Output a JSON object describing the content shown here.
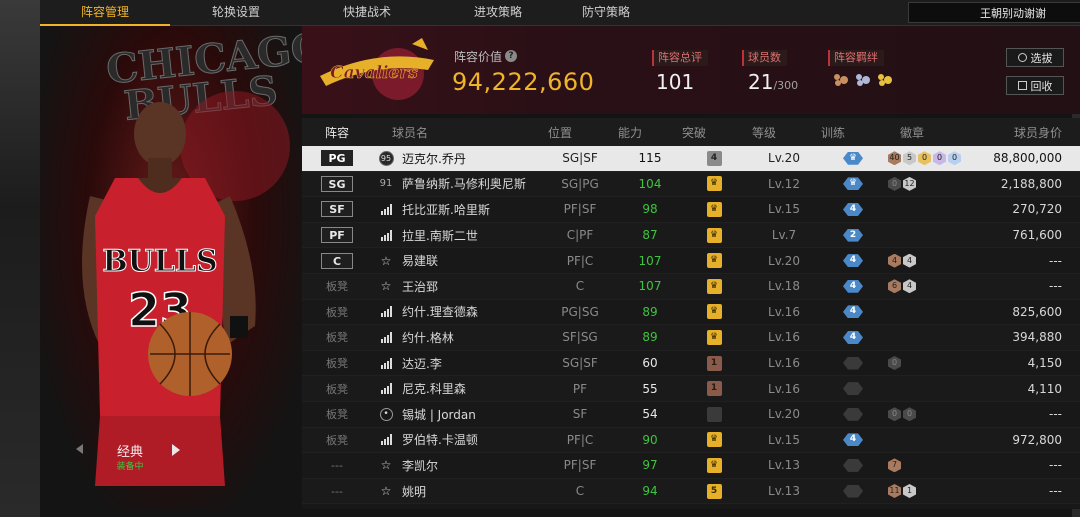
{
  "nav": {
    "tabs": [
      "阵容管理",
      "轮换设置",
      "快捷战术",
      "进攻策略",
      "防守策略"
    ],
    "active_tab": 0,
    "team_select": "王朝别动谢谢"
  },
  "player_card": {
    "style_name": "经典",
    "equipped_label": "装备中",
    "bg_text": "CHICAGO BULLS"
  },
  "summary": {
    "value_label": "阵容价值",
    "value": "94,222,660",
    "rating_label": "阵容总评",
    "rating": "101",
    "count_label": "球员数",
    "count": "21",
    "count_max": "/300",
    "bond_label": "阵容羁绊",
    "select_button": "选拔",
    "recycle_button": "回收"
  },
  "table": {
    "headers": [
      "阵容",
      "球员名",
      "位置",
      "能力",
      "突破",
      "等级",
      "训练",
      "徽章",
      "球员身价"
    ],
    "rows": [
      {
        "slot": "PG",
        "slot_type": "starter",
        "icon": "circle",
        "icon_text": "95",
        "name": "迈克尔.乔丹",
        "pos": "SG|SF",
        "ovr": "115",
        "ovr_color": "white",
        "brk": "4",
        "brk_type": "gray",
        "lvl": "Lv.20",
        "trn": "",
        "trn_type": "blue",
        "badges": [
          [
            "40",
            "br"
          ],
          [
            "5",
            "sv"
          ],
          [
            "0",
            "gd"
          ],
          [
            "0",
            "pu"
          ],
          [
            "0",
            "bl"
          ]
        ],
        "salary": "88,800,000",
        "selected": true
      },
      {
        "slot": "SG",
        "slot_type": "starter",
        "icon": "num",
        "icon_text": "91",
        "name": "萨鲁纳斯.马修利奥尼斯",
        "pos": "SG|PG",
        "ovr": "104",
        "ovr_color": "green",
        "brk": "",
        "brk_type": "gold",
        "lvl": "Lv.12",
        "trn": "",
        "trn_type": "blue",
        "badges": [
          [
            "0",
            "dk"
          ],
          [
            "12",
            "sv"
          ]
        ],
        "salary": "2,188,800"
      },
      {
        "slot": "SF",
        "slot_type": "starter",
        "icon": "bars",
        "icon_text": "",
        "name": "托比亚斯.哈里斯",
        "pos": "PF|SF",
        "ovr": "98",
        "ovr_color": "green",
        "brk": "",
        "brk_type": "gold",
        "lvl": "Lv.15",
        "trn": "4",
        "trn_type": "blue",
        "badges": [],
        "salary": "270,720"
      },
      {
        "slot": "PF",
        "slot_type": "starter",
        "icon": "bars",
        "icon_text": "",
        "name": "拉里.南斯二世",
        "pos": "C|PF",
        "ovr": "87",
        "ovr_color": "green",
        "brk": "",
        "brk_type": "gold",
        "lvl": "Lv.7",
        "trn": "2",
        "trn_type": "blue",
        "badges": [],
        "salary": "761,600"
      },
      {
        "slot": "C",
        "slot_type": "starter",
        "icon": "star",
        "icon_text": "",
        "name": "易建联",
        "pos": "PF|C",
        "ovr": "107",
        "ovr_color": "green",
        "brk": "",
        "brk_type": "gold",
        "lvl": "Lv.20",
        "trn": "4",
        "trn_type": "blue",
        "badges": [
          [
            "4",
            "br"
          ],
          [
            "4",
            "sv"
          ]
        ],
        "salary": "---"
      },
      {
        "slot": "板凳",
        "slot_type": "bench",
        "icon": "star",
        "icon_text": "",
        "name": "王治郅",
        "pos": "C",
        "ovr": "107",
        "ovr_color": "green",
        "brk": "",
        "brk_type": "gold",
        "lvl": "Lv.18",
        "trn": "4",
        "trn_type": "blue",
        "badges": [
          [
            "6",
            "br"
          ],
          [
            "4",
            "sv"
          ]
        ],
        "salary": "---"
      },
      {
        "slot": "板凳",
        "slot_type": "bench",
        "icon": "bars",
        "icon_text": "",
        "name": "约什.理查德森",
        "pos": "PG|SG",
        "ovr": "89",
        "ovr_color": "green",
        "brk": "",
        "brk_type": "gold",
        "lvl": "Lv.16",
        "trn": "4",
        "trn_type": "blue",
        "badges": [],
        "salary": "825,600"
      },
      {
        "slot": "板凳",
        "slot_type": "bench",
        "icon": "bars",
        "icon_text": "",
        "name": "约什.格林",
        "pos": "SF|SG",
        "ovr": "89",
        "ovr_color": "green",
        "brk": "",
        "brk_type": "gold",
        "lvl": "Lv.16",
        "trn": "4",
        "trn_type": "blue",
        "badges": [],
        "salary": "394,880"
      },
      {
        "slot": "板凳",
        "slot_type": "bench",
        "icon": "bars",
        "icon_text": "",
        "name": "达迈.李",
        "pos": "SG|SF",
        "ovr": "60",
        "ovr_color": "white",
        "brk": "1",
        "brk_type": "brown",
        "lvl": "Lv.16",
        "trn": "",
        "trn_type": "dark",
        "badges": [
          [
            "0",
            "dk"
          ]
        ],
        "salary": "4,150"
      },
      {
        "slot": "板凳",
        "slot_type": "bench",
        "icon": "bars",
        "icon_text": "",
        "name": "尼克.科里森",
        "pos": "PF",
        "ovr": "55",
        "ovr_color": "white",
        "brk": "1",
        "brk_type": "brown",
        "lvl": "Lv.16",
        "trn": "",
        "trn_type": "dark",
        "badges": [],
        "salary": "4,110"
      },
      {
        "slot": "板凳",
        "slot_type": "bench",
        "icon": "user",
        "icon_text": "",
        "name": "锡城 | Jordan",
        "pos": "SF",
        "ovr": "54",
        "ovr_color": "white",
        "brk": "",
        "brk_type": "dark",
        "lvl": "Lv.20",
        "trn": "",
        "trn_type": "dark",
        "badges": [
          [
            "0",
            "dk"
          ],
          [
            "0",
            "dk"
          ]
        ],
        "salary": "---"
      },
      {
        "slot": "板凳",
        "slot_type": "bench",
        "icon": "bars",
        "icon_text": "",
        "name": "罗伯特.卡温顿",
        "pos": "PF|C",
        "ovr": "90",
        "ovr_color": "green",
        "brk": "",
        "brk_type": "gold",
        "lvl": "Lv.15",
        "trn": "4",
        "trn_type": "blue",
        "badges": [],
        "salary": "972,800"
      },
      {
        "slot": "---",
        "slot_type": "none",
        "icon": "star",
        "icon_text": "",
        "name": "李凯尔",
        "pos": "PF|SF",
        "ovr": "97",
        "ovr_color": "green",
        "brk": "",
        "brk_type": "gold",
        "lvl": "Lv.13",
        "trn": "",
        "trn_type": "dark",
        "badges": [
          [
            "7",
            "br"
          ]
        ],
        "salary": "---"
      },
      {
        "slot": "---",
        "slot_type": "none",
        "icon": "star",
        "icon_text": "",
        "name": "姚明",
        "pos": "C",
        "ovr": "94",
        "ovr_color": "green",
        "brk": "5",
        "brk_type": "gold",
        "lvl": "Lv.13",
        "trn": "",
        "trn_type": "dark",
        "badges": [
          [
            "11",
            "br"
          ],
          [
            "1",
            "sv"
          ]
        ],
        "salary": "---"
      }
    ]
  },
  "colors": {
    "accent": "#f0b429",
    "green": "#3ec43e",
    "training_blue": "#4a88c8"
  }
}
